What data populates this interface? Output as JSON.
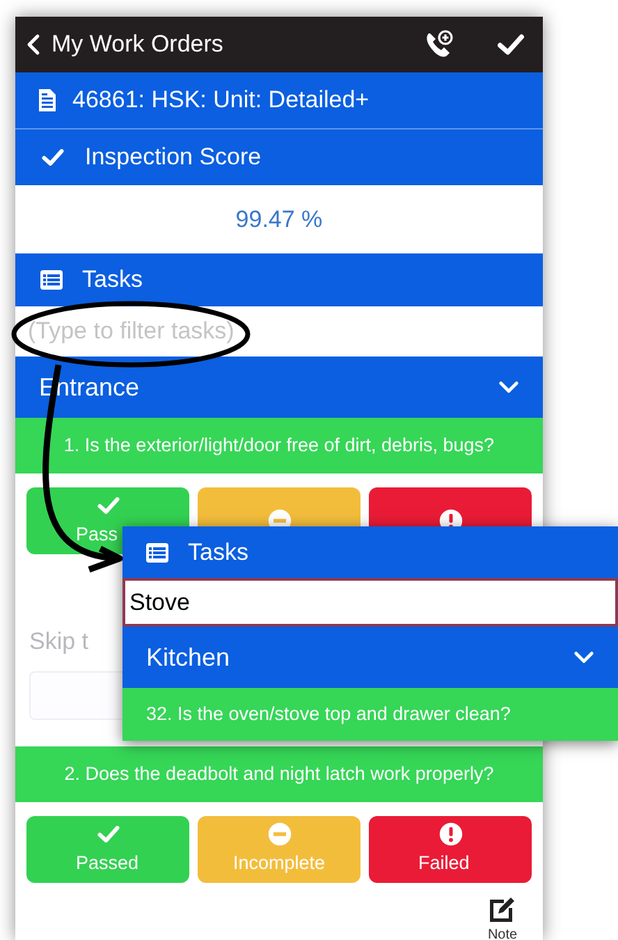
{
  "header": {
    "back_label": "My Work Orders"
  },
  "work_order": {
    "title": "46861: HSK: Unit: Detailed+"
  },
  "score": {
    "title": "Inspection Score",
    "value": "99.47 %"
  },
  "tasks": {
    "title": "Tasks",
    "filter": {
      "placeholder": "(Type to filter tasks)"
    }
  },
  "section": {
    "title": "Entrance",
    "expanded": true
  },
  "items": [
    {
      "question": "1. Is the exterior/light/door free of dirt, debris, bugs?",
      "buttons": [
        {
          "kind": "passed",
          "label": "Pass"
        },
        {
          "kind": "incomplete"
        },
        {
          "kind": "failed"
        }
      ],
      "skip_label": "Skip t"
    },
    {
      "question": "2. Does the deadbolt and night latch work properly?",
      "buttons": [
        {
          "kind": "passed",
          "label": "Passed"
        },
        {
          "kind": "incomplete",
          "label": "Incomplete"
        },
        {
          "kind": "failed",
          "label": "Failed"
        }
      ],
      "note_label": "Note"
    }
  ],
  "popup": {
    "title": "Tasks",
    "filter": {
      "value": "Stove"
    },
    "section": {
      "title": "Kitchen",
      "expanded": true
    },
    "question": "32. Is the oven/stove top and drawer clean?"
  }
}
